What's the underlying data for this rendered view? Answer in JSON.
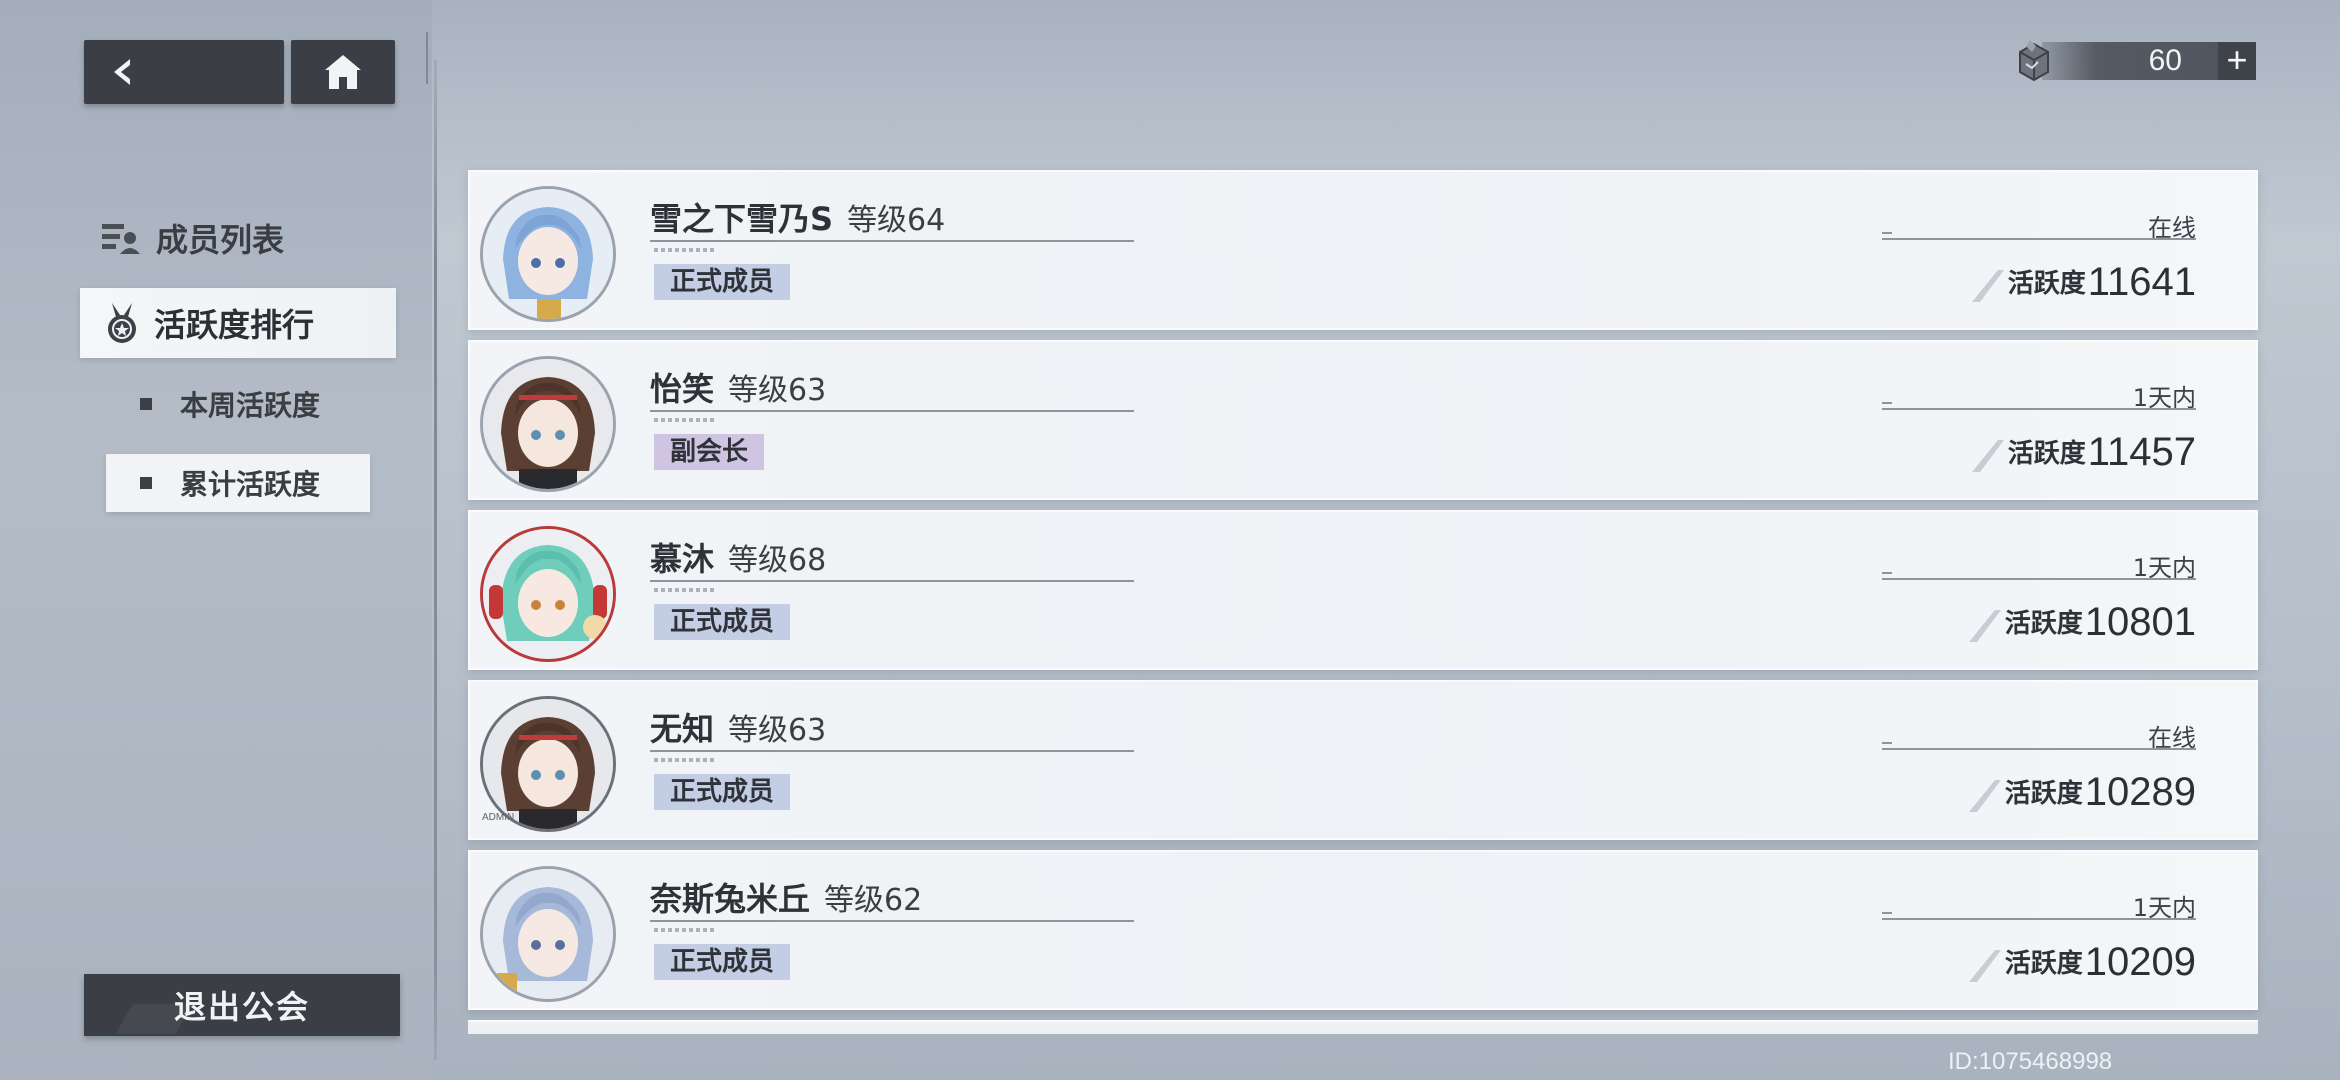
{
  "currency": {
    "value": "60",
    "plus": "+"
  },
  "nav": {
    "members": "成员列表",
    "activity_ranking": "活跃度排行",
    "weekly": "本周活跃度",
    "total": "累计活跃度",
    "quit": "退出公会"
  },
  "members": [
    {
      "name": "雪之下雪乃S",
      "level": "等级64",
      "rank": "正式成员",
      "status": "在线",
      "activity_label": "活跃度",
      "activity": "11641"
    },
    {
      "name": "怡笑",
      "level": "等级63",
      "rank": "副会长",
      "status": "1天内",
      "activity_label": "活跃度",
      "activity": "11457"
    },
    {
      "name": "慕沐",
      "level": "等级68",
      "rank": "正式成员",
      "status": "1天内",
      "activity_label": "活跃度",
      "activity": "10801"
    },
    {
      "name": "无知",
      "level": "等级63",
      "rank": "正式成员",
      "status": "在线",
      "activity_label": "活跃度",
      "activity": "10289"
    },
    {
      "name": "奈斯兔米丘",
      "level": "等级62",
      "rank": "正式成员",
      "status": "1天内",
      "activity_label": "活跃度",
      "activity": "10209"
    }
  ],
  "avatar_badge": "ADMIN",
  "uid": "ID:1075468998",
  "colors": {
    "dark_button": "#3b3e44",
    "rank_formal": "#c3cde3",
    "rank_vice": "#cfc4e2"
  }
}
